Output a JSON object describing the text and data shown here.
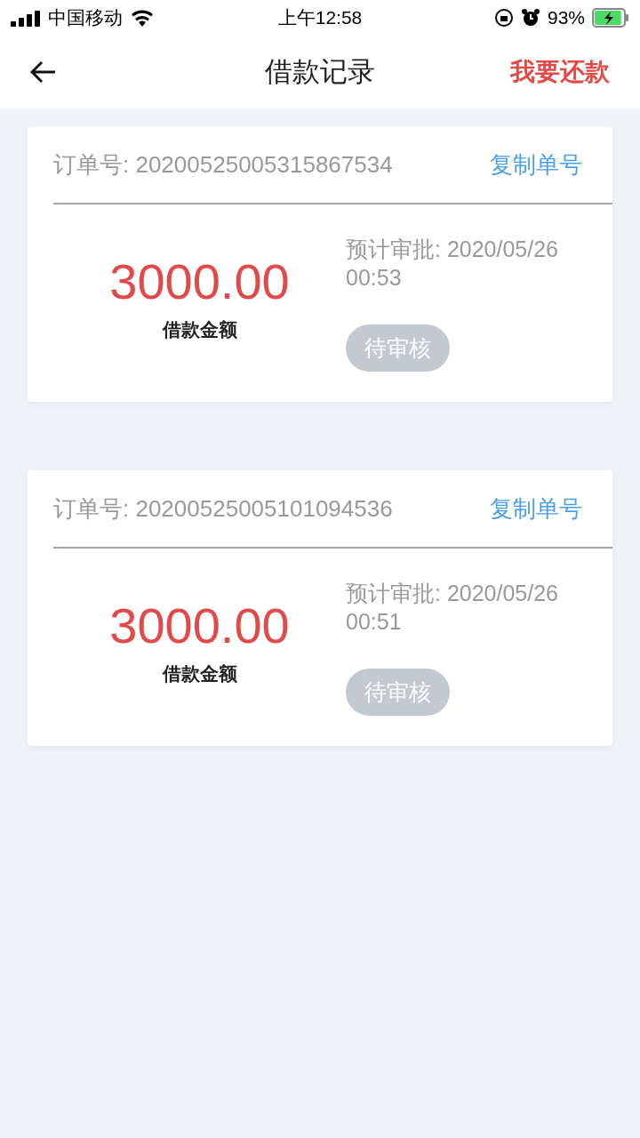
{
  "status_bar": {
    "carrier": "中国移动",
    "time": "上午12:58",
    "battery_text": "93%",
    "battery": {
      "level": 0.93,
      "charging": true
    }
  },
  "header": {
    "title": "借款记录",
    "action": "我要还款"
  },
  "orders": [
    {
      "order_label": "订单号: 20200525005315867534",
      "copy_label": "复制单号",
      "amount": "3000.00",
      "amount_label": "借款金额",
      "approval": "预计审批: 2020/05/26 00:53",
      "status": "待审核"
    },
    {
      "order_label": "订单号: 20200525005101094536",
      "copy_label": "复制单号",
      "amount": "3000.00",
      "amount_label": "借款金额",
      "approval": "预计审批: 2020/05/26 00:51",
      "status": "待审核"
    }
  ]
}
